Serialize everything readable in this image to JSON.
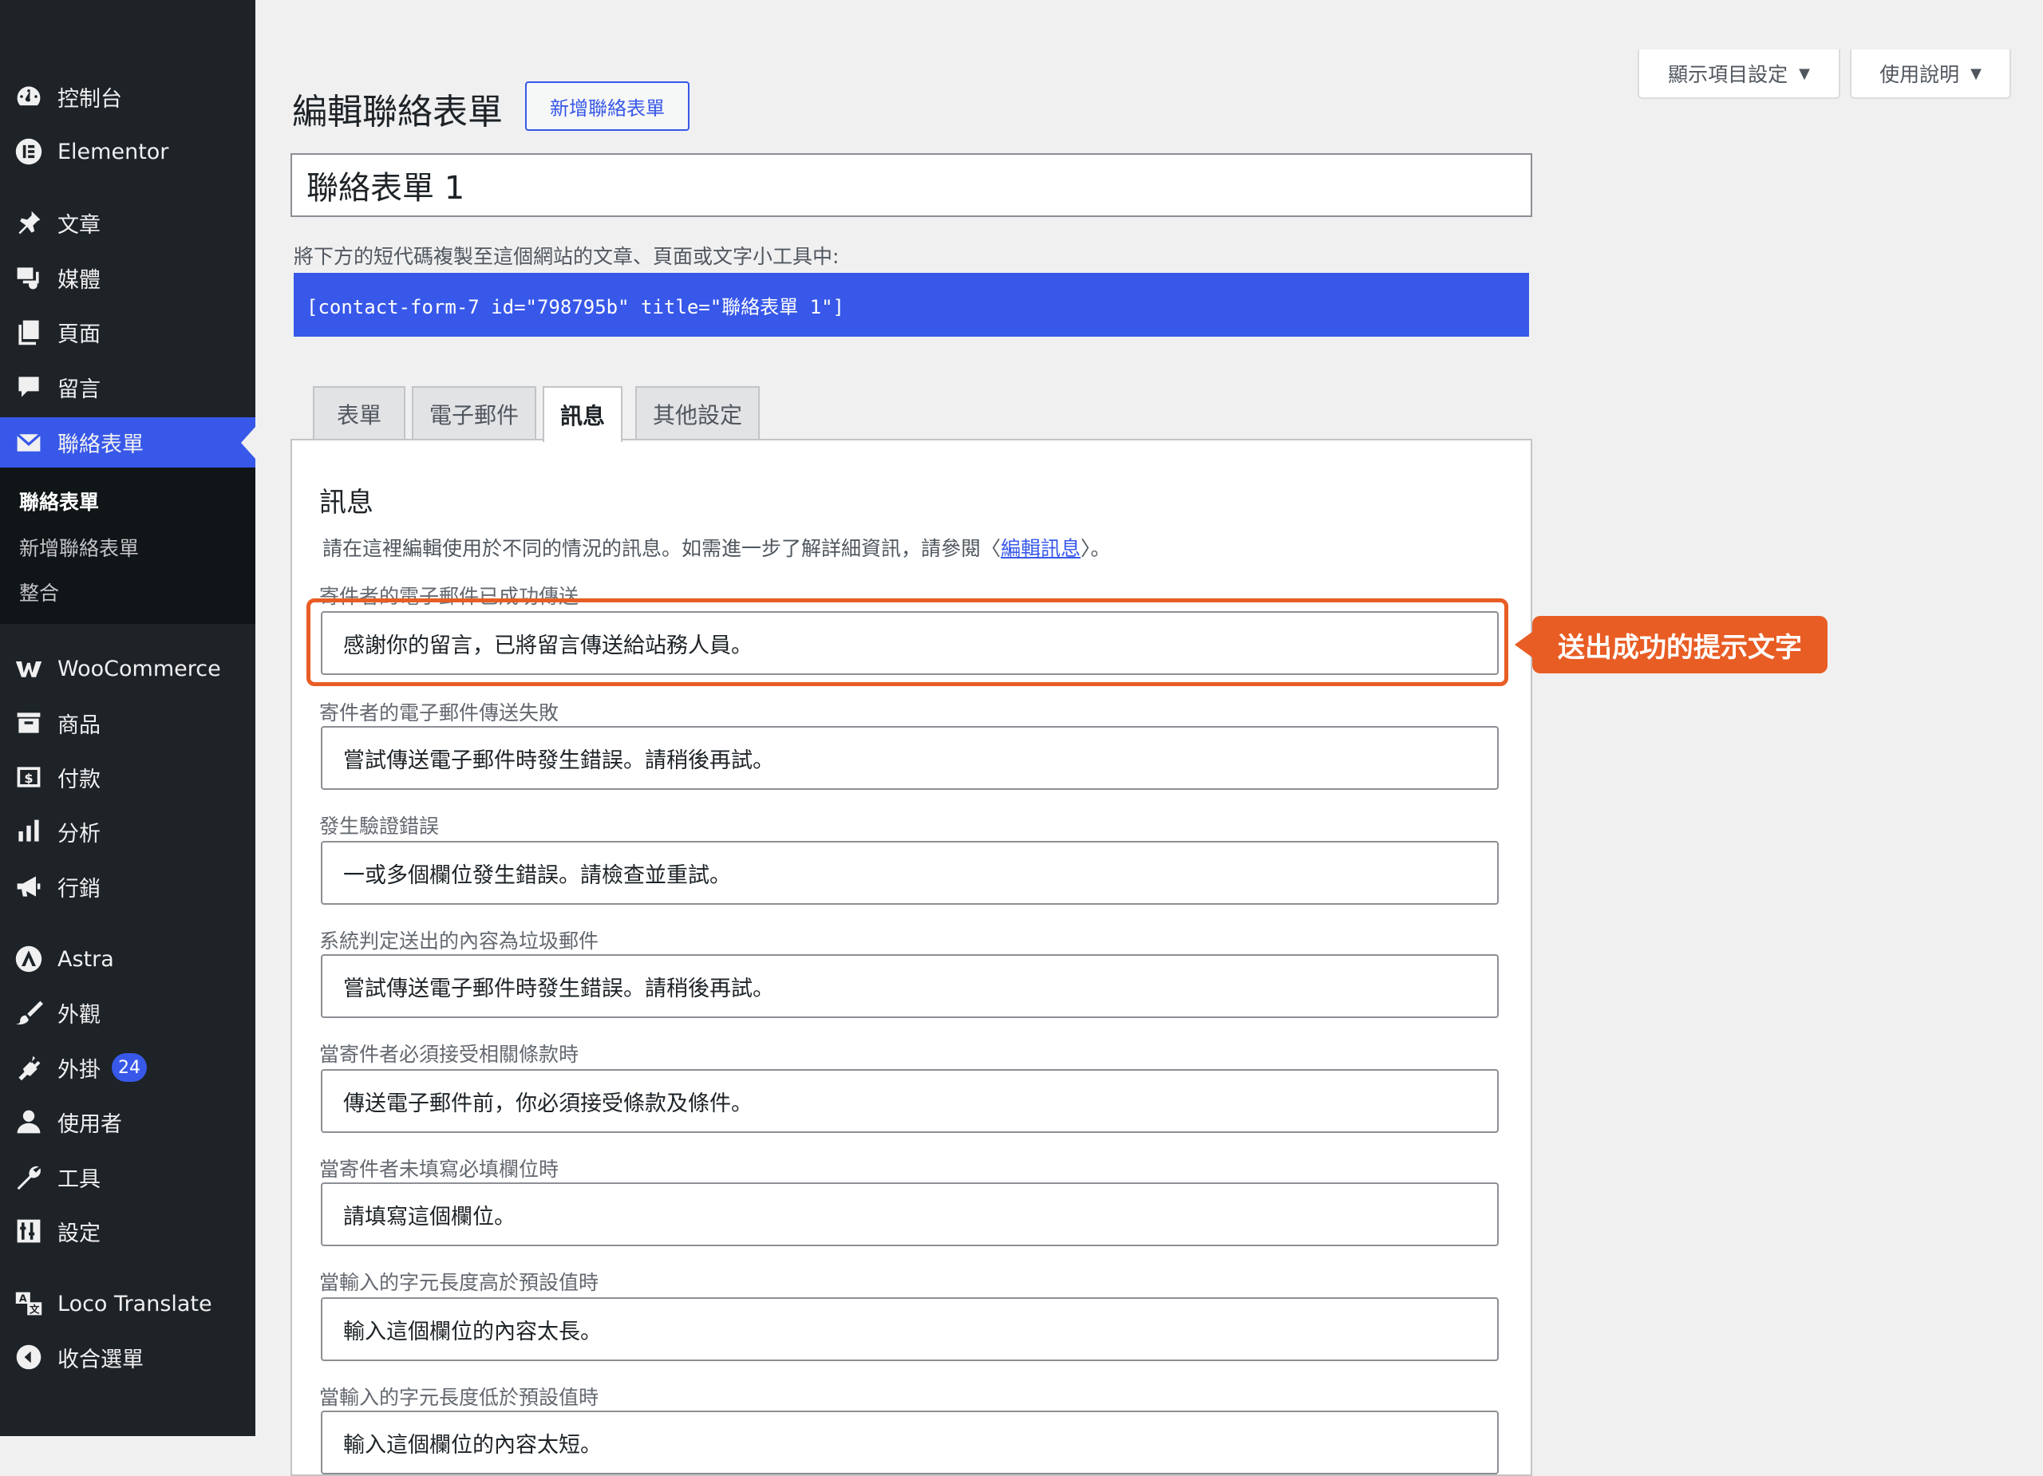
{
  "sidebar": {
    "items": [
      {
        "label": "控制台",
        "icon": "dashboard-icon"
      },
      {
        "label": "Elementor",
        "icon": "elementor-icon"
      },
      {
        "label": "文章",
        "icon": "pin-icon"
      },
      {
        "label": "媒體",
        "icon": "media-icon"
      },
      {
        "label": "頁面",
        "icon": "pages-icon"
      },
      {
        "label": "留言",
        "icon": "comment-icon"
      },
      {
        "label": "聯絡表單",
        "icon": "mail-icon"
      },
      {
        "label": "WooCommerce",
        "icon": "woocommerce-icon"
      },
      {
        "label": "商品",
        "icon": "products-icon"
      },
      {
        "label": "付款",
        "icon": "payments-icon"
      },
      {
        "label": "分析",
        "icon": "analytics-icon"
      },
      {
        "label": "行銷",
        "icon": "megaphone-icon"
      },
      {
        "label": "Astra",
        "icon": "astra-icon"
      },
      {
        "label": "外觀",
        "icon": "paintbrush-icon"
      },
      {
        "label": "外掛",
        "icon": "plugin-icon",
        "badge": "24"
      },
      {
        "label": "使用者",
        "icon": "user-icon"
      },
      {
        "label": "工具",
        "icon": "wrench-icon"
      },
      {
        "label": "設定",
        "icon": "settings-icon"
      },
      {
        "label": "Loco Translate",
        "icon": "translate-icon"
      },
      {
        "label": "收合選單",
        "icon": "collapse-icon"
      }
    ],
    "submenu": [
      "聯絡表單",
      "新增聯絡表單",
      "整合"
    ]
  },
  "header": {
    "screen_options": "顯示項目設定",
    "help": "使用說明",
    "title": "編輯聯絡表單",
    "add_new": "新增聯絡表單"
  },
  "form": {
    "title_value": "聯絡表單 1",
    "shortcode_desc": "將下方的短代碼複製至這個網站的文章、頁面或文字小工具中:",
    "shortcode": "[contact-form-7 id=\"798795b\" title=\"聯絡表單 1\"]"
  },
  "tabs": [
    "表單",
    "電子郵件",
    "訊息",
    "其他設定"
  ],
  "panel": {
    "heading": "訊息",
    "desc_prefix": "請在這裡編輯使用於不同的情況的訊息。如需進一步了解詳細資訊，請參閱〈",
    "desc_link": "編輯訊息",
    "desc_suffix": "〉。",
    "fields": [
      {
        "label": "寄件者的電子郵件已成功傳送",
        "value": "感謝你的留言，已將留言傳送給站務人員。"
      },
      {
        "label": "寄件者的電子郵件傳送失敗",
        "value": "嘗試傳送電子郵件時發生錯誤。請稍後再試。"
      },
      {
        "label": "發生驗證錯誤",
        "value": "一或多個欄位發生錯誤。請檢查並重試。"
      },
      {
        "label": "系統判定送出的內容為垃圾郵件",
        "value": "嘗試傳送電子郵件時發生錯誤。請稍後再試。"
      },
      {
        "label": "當寄件者必須接受相關條款時",
        "value": "傳送電子郵件前，你必須接受條款及條件。"
      },
      {
        "label": "當寄件者未填寫必填欄位時",
        "value": "請填寫這個欄位。"
      },
      {
        "label": "當輸入的字元長度高於預設值時",
        "value": "輸入這個欄位的內容太長。"
      },
      {
        "label": "當輸入的字元長度低於預設值時",
        "value": "輸入這個欄位的內容太短。"
      }
    ]
  },
  "annotation": {
    "callout": "送出成功的提示文字",
    "color": "#e85d24"
  },
  "colors": {
    "accent": "#3858e9",
    "sidebar_bg": "#1d2327",
    "submenu_bg": "#101517"
  }
}
